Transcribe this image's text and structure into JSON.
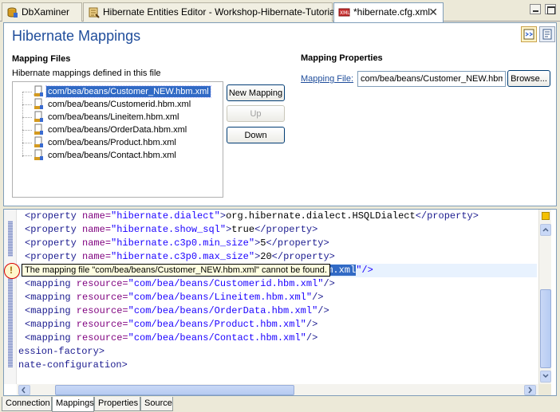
{
  "window_tabs": [
    {
      "label": "DbXaminer",
      "icon": "db-icon"
    },
    {
      "label": "Hibernate Entities Editor - Workshop-Hibernate-Tutorial",
      "icon": "entities-editor-icon"
    },
    {
      "label": "*hibernate.cfg.xml",
      "icon": "xml-file-icon",
      "active": true
    }
  ],
  "form": {
    "title": "Hibernate Mappings",
    "mapping_files": {
      "title": "Mapping Files",
      "description": "Hibernate mappings defined in this file",
      "items": [
        {
          "label": "com/bea/beans/Customer_NEW.hbm.xml",
          "selected": true
        },
        {
          "label": "com/bea/beans/Customerid.hbm.xml"
        },
        {
          "label": "com/bea/beans/Lineitem.hbm.xml"
        },
        {
          "label": "com/bea/beans/OrderData.hbm.xml"
        },
        {
          "label": "com/bea/beans/Product.hbm.xml"
        },
        {
          "label": "com/bea/beans/Contact.hbm.xml"
        }
      ],
      "buttons": {
        "new": "New Mapping",
        "up": "Up",
        "down": "Down"
      }
    },
    "mapping_properties": {
      "title": "Mapping Properties",
      "file_label": "Mapping File:",
      "file_value": "com/bea/beans/Customer_NEW.hbm",
      "browse": "Browse..."
    }
  },
  "source": {
    "lines": [
      {
        "indent": "  ",
        "open": "<property",
        "attr": " name=",
        "val": "\"hibernate.dialect\"",
        "close": ">",
        "text": "org.hibernate.dialect.HSQLDialect",
        "end": "</property>"
      },
      {
        "indent": "  ",
        "open": "<property",
        "attr": " name=",
        "val": "\"hibernate.show_sql\"",
        "close": ">",
        "text": "true",
        "end": "</property>"
      },
      {
        "indent": "  ",
        "open": "<property",
        "attr": " name=",
        "val": "\"hibernate.c3p0.min_size\"",
        "close": ">",
        "text": "5",
        "end": "</property>"
      },
      {
        "indent": "  ",
        "open": "<property",
        "attr": " name=",
        "val": "\"hibernate.c3p0.max_size\"",
        "close": ">",
        "text": "20",
        "end": "</property>"
      },
      {
        "indent": "",
        "open": "",
        "attr": "",
        "val": "",
        "close": "",
        "text": "",
        "end": ""
      },
      {
        "indent": "  ",
        "open": "<mapping",
        "attr": " resource=",
        "val": "\"com/bea/beans/Customerid.hbm.xml\"",
        "close": "/>",
        "text": "",
        "end": ""
      },
      {
        "indent": "  ",
        "open": "<mapping",
        "attr": " resource=",
        "val": "\"com/bea/beans/Lineitem.hbm.xml\"",
        "close": "/>",
        "text": "",
        "end": ""
      },
      {
        "indent": "  ",
        "open": "<mapping",
        "attr": " resource=",
        "val": "\"com/bea/beans/OrderData.hbm.xml\"",
        "close": "/>",
        "text": "",
        "end": ""
      },
      {
        "indent": "  ",
        "open": "<mapping",
        "attr": " resource=",
        "val": "\"com/bea/beans/Product.hbm.xml\"",
        "close": "/>",
        "text": "",
        "end": ""
      },
      {
        "indent": "  ",
        "open": "<mapping",
        "attr": " resource=",
        "val": "\"com/bea/beans/Contact.hbm.xml\"",
        "close": "/>",
        "text": "",
        "end": ""
      },
      {
        "indent": "",
        "open": "ession-factory>",
        "attr": "",
        "val": "",
        "close": "",
        "text": "",
        "end": ""
      },
      {
        "indent": "",
        "open": "nate-configuration>",
        "attr": "",
        "val": "",
        "close": "",
        "text": "",
        "end": ""
      }
    ],
    "error_line_selected": "bm.xml",
    "error_line_rest": "\"/>",
    "tooltip": "The mapping file \"com/bea/beans/Customer_NEW.hbm.xml\" cannot be found."
  },
  "page_tabs": [
    {
      "label": "Connection"
    },
    {
      "label": "Mappings",
      "active": true
    },
    {
      "label": "Properties"
    },
    {
      "label": "Source"
    }
  ]
}
